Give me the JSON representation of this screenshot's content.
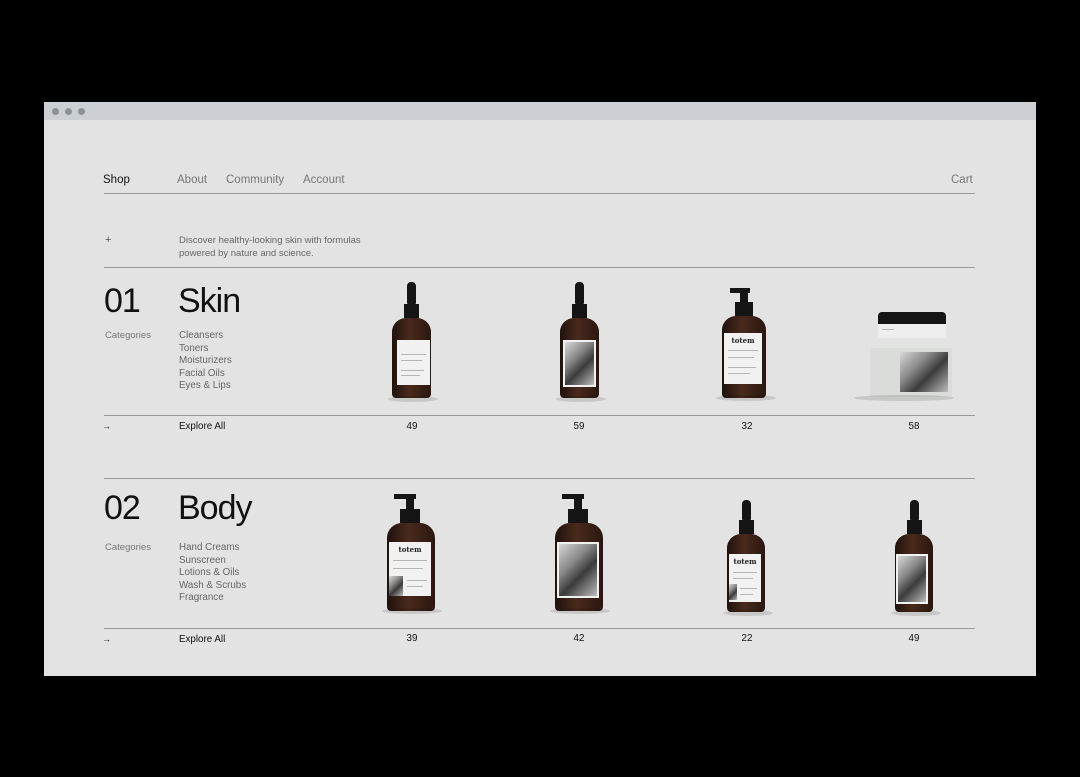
{
  "nav": {
    "shop": "Shop",
    "about": "About",
    "community": "Community",
    "account": "Account",
    "cart": "Cart"
  },
  "intro": {
    "plus": "+",
    "line1": "Discover healthy-looking skin with formulas",
    "line2": "powered by nature and science."
  },
  "sections": [
    {
      "number": "01",
      "title": "Skin",
      "categories_label": "Categories",
      "subcategories": [
        "Cleansers",
        "Toners",
        "Moisturizers",
        "Facial Oils",
        "Eyes & Lips"
      ],
      "arrow": "→",
      "explore_label": "Explore All",
      "products": [
        {
          "type": "dropper",
          "label": "text",
          "brand": "",
          "count": "49"
        },
        {
          "type": "dropper",
          "label": "photo",
          "brand": "",
          "count": "59"
        },
        {
          "type": "pump",
          "label": "text",
          "brand": "totem",
          "count": "32"
        },
        {
          "type": "jar",
          "label": "photo",
          "brand": "",
          "count": "58"
        }
      ]
    },
    {
      "number": "02",
      "title": "Body",
      "categories_label": "Categories",
      "subcategories": [
        "Hand Creams",
        "Sunscreen",
        "Lotions & Oils",
        "Wash & Scrubs",
        "Fragrance"
      ],
      "arrow": "→",
      "explore_label": "Explore All",
      "products": [
        {
          "type": "pump",
          "label": "text",
          "brand": "totem",
          "count": "39"
        },
        {
          "type": "pump",
          "label": "photo",
          "brand": "",
          "count": "42"
        },
        {
          "type": "dropper",
          "label": "text",
          "brand": "totem",
          "count": "22"
        },
        {
          "type": "dropper",
          "label": "photo",
          "brand": "",
          "count": "49"
        }
      ]
    }
  ],
  "colors": {
    "page_background": "#e3e3e3",
    "bottle": "#3a2216",
    "text_primary": "#111111",
    "text_secondary": "#777777"
  }
}
